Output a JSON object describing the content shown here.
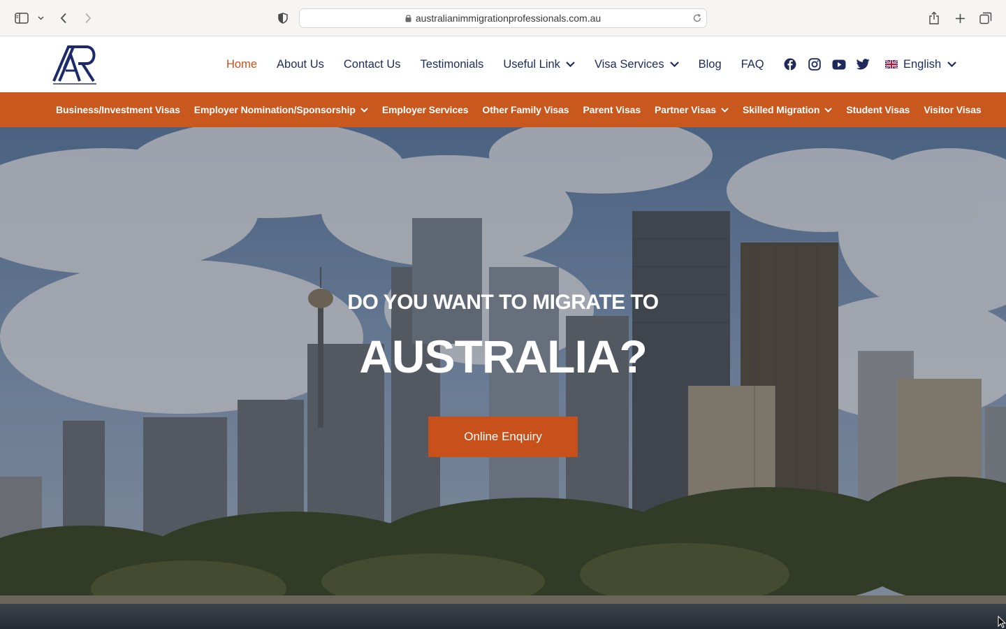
{
  "browser": {
    "url": "australianimmigrationprofessionals.com.au"
  },
  "header": {
    "logo_text": "Australian Immigration Professionals",
    "nav": [
      {
        "label": "Home"
      },
      {
        "label": "About Us"
      },
      {
        "label": "Contact Us"
      },
      {
        "label": "Testimonials"
      },
      {
        "label": "Useful Link"
      },
      {
        "label": "Visa Services"
      },
      {
        "label": "Blog"
      },
      {
        "label": "FAQ"
      }
    ],
    "social_icons": [
      "facebook-icon",
      "instagram-icon",
      "youtube-icon",
      "twitter-icon"
    ],
    "language": "English"
  },
  "visa_nav": [
    {
      "label": "Business/Investment Visas"
    },
    {
      "label": "Employer Nomination/Sponsorship"
    },
    {
      "label": "Employer Services"
    },
    {
      "label": "Other Family Visas"
    },
    {
      "label": "Parent Visas"
    },
    {
      "label": "Partner Visas"
    },
    {
      "label": "Skilled Migration"
    },
    {
      "label": "Student Visas"
    },
    {
      "label": "Visitor Visas"
    }
  ],
  "hero": {
    "subtitle": "DO YOU WANT TO MIGRATE TO",
    "title": "AUSTRALIA?",
    "cta": "Online Enquiry"
  },
  "colors": {
    "accent": "#c8501a",
    "nav_bar": "#c8581e",
    "nav_text": "#1f2a5c"
  }
}
